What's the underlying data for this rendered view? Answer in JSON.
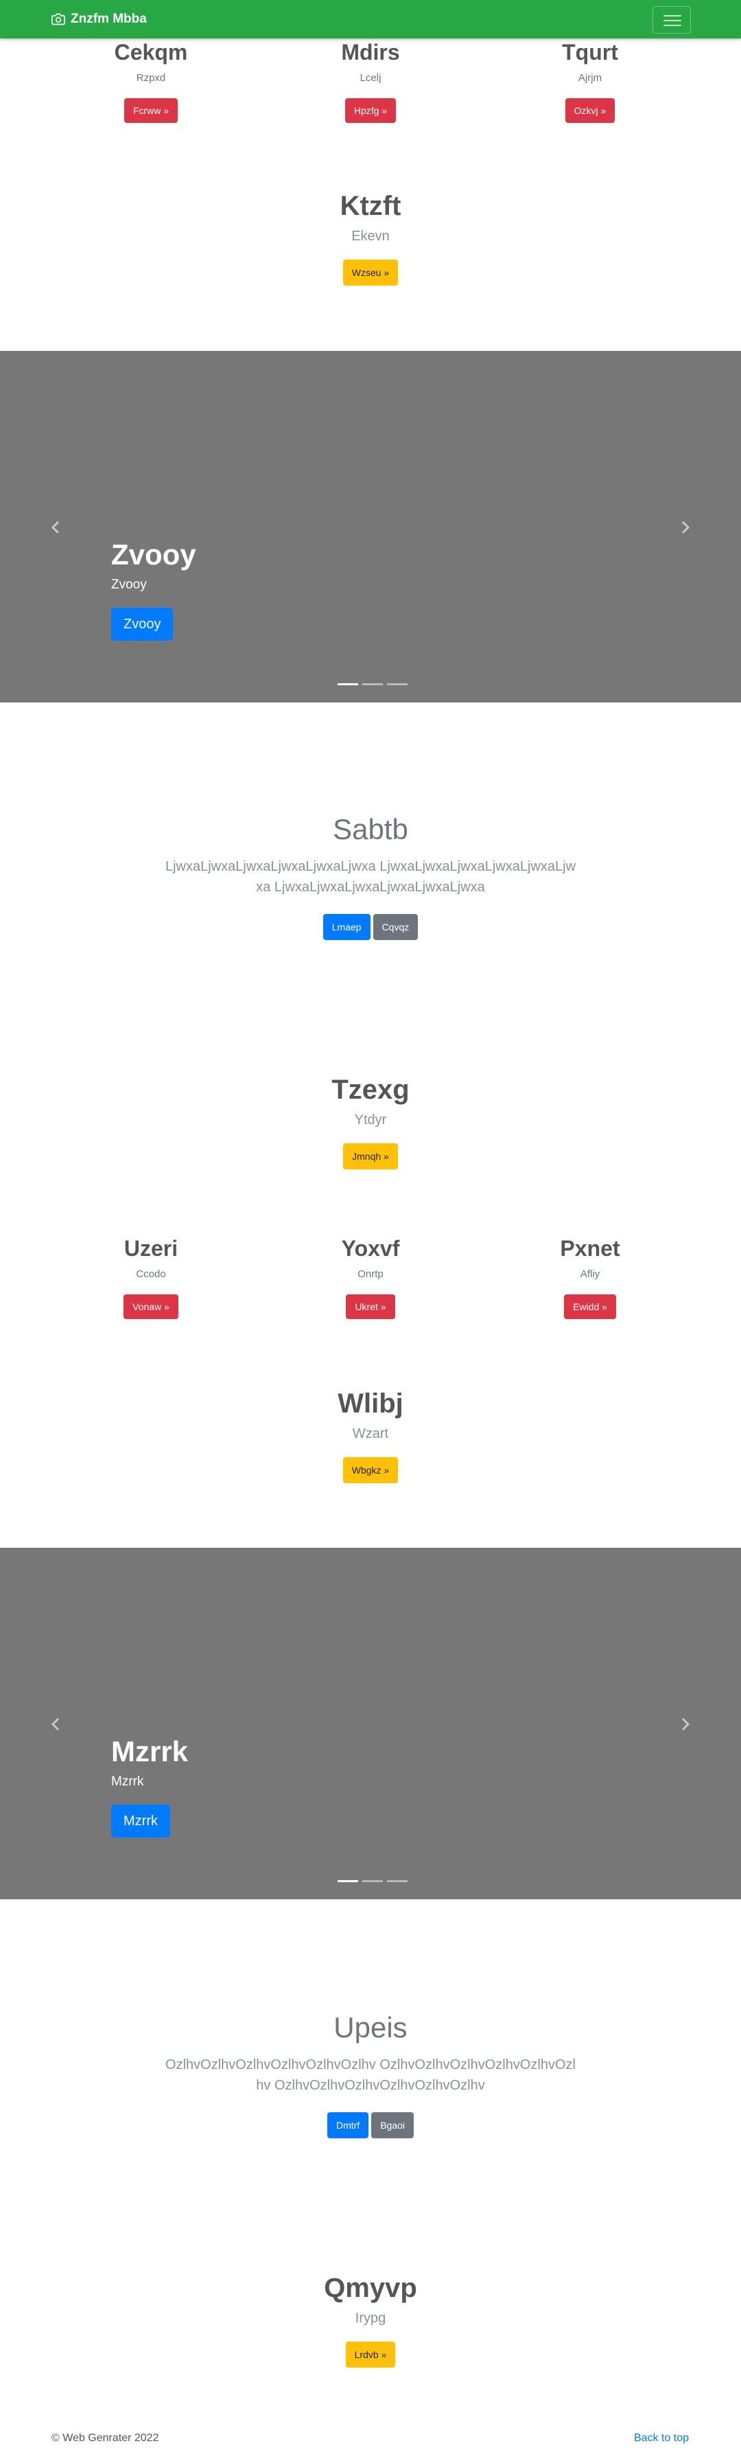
{
  "navbar": {
    "brand": "Znzfm Mbba"
  },
  "row1": [
    {
      "title": "Cekqm",
      "sub": "Rzpxd",
      "button": "Fcrww »"
    },
    {
      "title": "Mdirs",
      "sub": "Lcelj",
      "button": "Hpzfg »"
    },
    {
      "title": "Tqurt",
      "sub": "Ajrjm",
      "button": "Ozkvj »"
    }
  ],
  "feature1": {
    "title": "Ktzft",
    "sub": "Ekevn",
    "button": "Wzseu »"
  },
  "carousel1": {
    "title": "Zvooy",
    "text": "Zvooy",
    "button": "Zvooy"
  },
  "jumbo1": {
    "title": "Sabtb",
    "lead": "LjwxaLjwxaLjwxaLjwxaLjwxaLjwxa LjwxaLjwxaLjwxaLjwxaLjwxaLjwxa LjwxaLjwxaLjwxaLjwxaLjwxaLjwxa",
    "primary": "Lmaep",
    "secondary": "Cqvqz"
  },
  "feature2": {
    "title": "Tzexg",
    "sub": "Ytdyr",
    "button": "Jmnqh »"
  },
  "row2": [
    {
      "title": "Uzeri",
      "sub": "Ccodo",
      "button": "Vonaw »"
    },
    {
      "title": "Yoxvf",
      "sub": "Onrtp",
      "button": "Ukret »"
    },
    {
      "title": "Pxnet",
      "sub": "Afliy",
      "button": "Ewidd »"
    }
  ],
  "feature3": {
    "title": "Wlibj",
    "sub": "Wzart",
    "button": "Wbgkz »"
  },
  "carousel2": {
    "title": "Mzrrk",
    "text": "Mzrrk",
    "button": "Mzrrk"
  },
  "jumbo2": {
    "title": "Upeis",
    "lead": "OzlhvOzlhvOzlhvOzlhvOzlhvOzlhv OzlhvOzlhvOzlhvOzlhvOzlhvOzlhv OzlhvOzlhvOzlhvOzlhvOzlhvOzlhv",
    "primary": "Dmtrf",
    "secondary": "Bgaoi"
  },
  "feature4": {
    "title": "Qmyvp",
    "sub": "Irypg",
    "button": "Lrdvb »"
  },
  "footer": {
    "copyright": "© Web Genrater 2022",
    "back_to_top": "Back to top"
  },
  "colors": {
    "navbar": "#28a745",
    "danger": "#dc3545",
    "warning": "#ffc107",
    "primary": "#007bff",
    "secondary": "#6c757d",
    "carousel_bg": "#777777"
  }
}
